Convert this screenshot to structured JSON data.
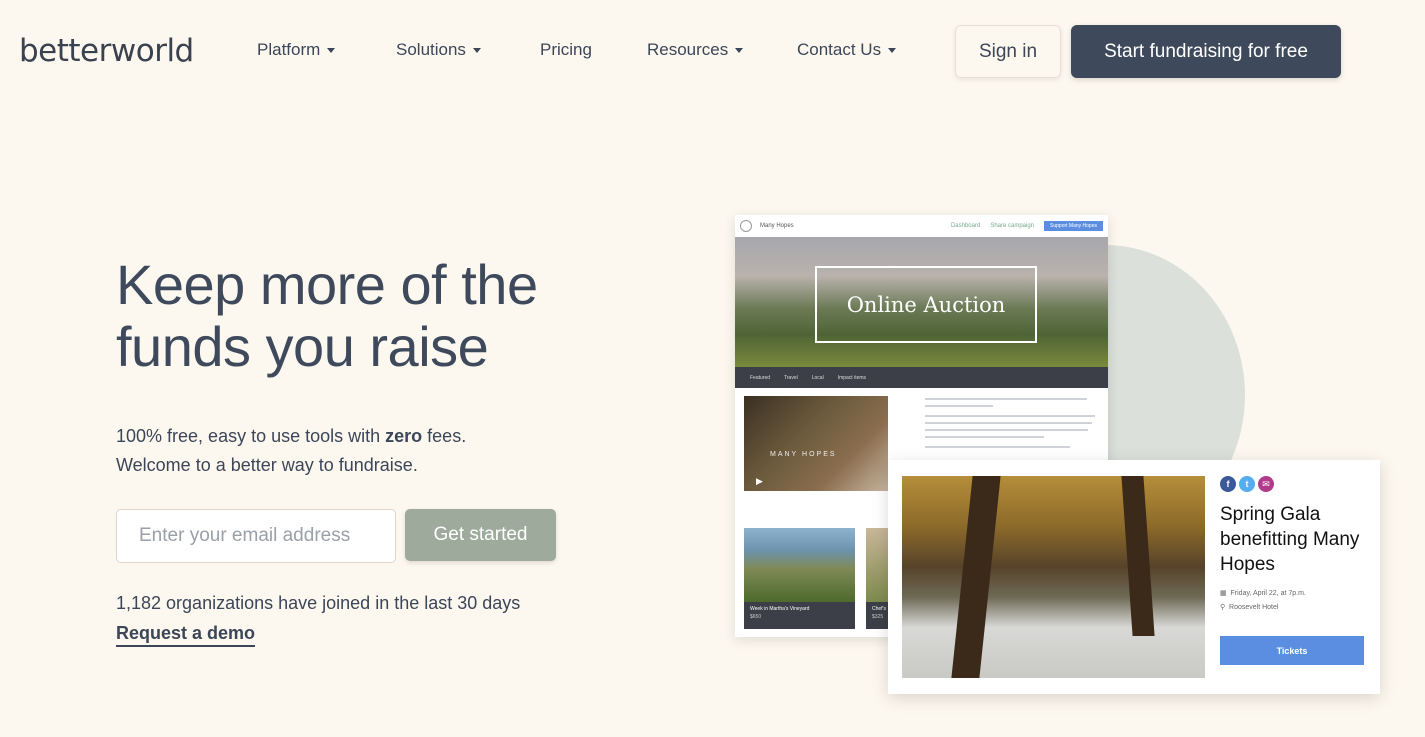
{
  "nav": {
    "logo": "betterworld",
    "items": [
      {
        "label": "Platform",
        "dropdown": true
      },
      {
        "label": "Solutions",
        "dropdown": true
      },
      {
        "label": "Pricing",
        "dropdown": false
      },
      {
        "label": "Resources",
        "dropdown": true
      },
      {
        "label": "Contact Us",
        "dropdown": true
      }
    ],
    "signin": "Sign in",
    "cta": "Start fundraising for free"
  },
  "hero": {
    "headline_line1": "Keep more of the",
    "headline_line2": "funds you raise",
    "sub_part1": "100% free, easy to use tools with ",
    "sub_bold": "zero",
    "sub_part2": " fees.",
    "sub_line2": "Welcome to a better way to fundraise.",
    "email_placeholder": "Enter your email address",
    "get_started": "Get started",
    "joined": "1,182 organizations have joined in the last 30 days",
    "demo": "Request a demo"
  },
  "mockup": {
    "org_name": "Many Hopes",
    "link1": "Dashboard",
    "link2": "Share campaign",
    "support": "Support Many Hopes",
    "banner_title": "Online Auction",
    "tabs": [
      "Featured",
      "Travel",
      "Local",
      "Impact items"
    ],
    "video_label": "MANY HOPES",
    "thumb1_title": "Week in Martha's Vineyard",
    "thumb1_price": "$650",
    "thumb2_title": "Chef's",
    "thumb2_price": "$325"
  },
  "gala": {
    "title": "Spring Gala benefitting Many Hopes",
    "date": "Friday, April 22, at 7p.m.",
    "location": "Roosevelt Hotel",
    "tickets": "Tickets"
  },
  "colors": {
    "background": "#fdf8ef",
    "primary_dark": "#3e4a5c",
    "get_started": "#9daa9c",
    "accent_blue": "#5b8ee0"
  }
}
